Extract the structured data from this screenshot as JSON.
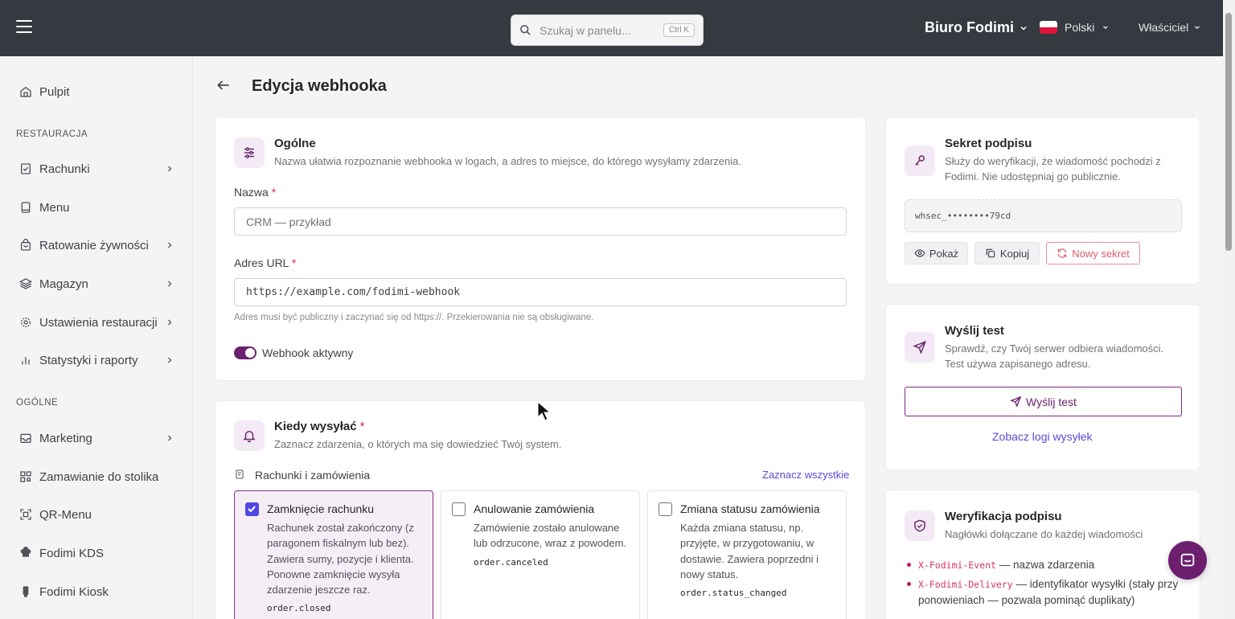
{
  "topbar": {
    "search_placeholder": "Szukaj w panelu...",
    "search_shortcut": "Ctrl K",
    "business_name": "Biuro Fodimi",
    "language": "Polski",
    "role": "Właściciel"
  },
  "sidebar": {
    "dashboard": "Pulpit",
    "section_restaurant": "RESTAURACJA",
    "items_restaurant": [
      {
        "label": "Rachunki",
        "icon": "receipt-icon"
      },
      {
        "label": "Menu",
        "icon": "book-icon"
      },
      {
        "label": "Ratowanie żywności",
        "icon": "bag-icon"
      },
      {
        "label": "Magazyn",
        "icon": "layers-icon"
      },
      {
        "label": "Ustawienia restauracji",
        "icon": "gear-icon"
      },
      {
        "label": "Statystyki i raporty",
        "icon": "chart-icon"
      }
    ],
    "section_general": "OGÓLNE",
    "items_general": [
      {
        "label": "Marketing",
        "icon": "inbox-icon"
      },
      {
        "label": "Zamawianie do stolika",
        "icon": "qr-icon"
      },
      {
        "label": "QR-Menu",
        "icon": "qr-scan-icon"
      },
      {
        "label": "Fodimi KDS",
        "icon": "chef-hat-icon"
      },
      {
        "label": "Fodimi Kiosk",
        "icon": "kiosk-icon"
      }
    ]
  },
  "page": {
    "title": "Edycja webhooka"
  },
  "general": {
    "title": "Ogólne",
    "subtitle": "Nazwa ułatwia rozpoznanie webhooka w logach, a adres to miejsce, do którego wysyłamy zdarzenia.",
    "name_label": "Nazwa",
    "name_value": "CRM — przykład",
    "url_label": "Adres URL",
    "url_value": "https://example.com/fodimi-webhook",
    "url_hint": "Adres musi być publiczny i zaczynać się od https://. Przekierowania nie są obsługiwane.",
    "active_label": "Webhook aktywny",
    "active": true
  },
  "events": {
    "title": "Kiedy wysyłać",
    "subtitle": "Zaznacz zdarzenia, o których ma się dowiedzieć Twój system.",
    "group_title": "Rachunki i zamówienia",
    "select_all": "Zaznacz wszystkie",
    "items": [
      {
        "title": "Zamknięcie rachunku",
        "desc": "Rachunek został zakończony (z paragonem fiskalnym lub bez). Zawiera sumy, pozycje i klienta. Ponowne zamknięcie wysyła zdarzenie jeszcze raz.",
        "code": "order.closed",
        "checked": true
      },
      {
        "title": "Anulowanie zamówienia",
        "desc": "Zamówienie zostało anulowane lub odrzucone, wraz z powodem.",
        "code": "order.canceled",
        "checked": false
      },
      {
        "title": "Zmiana statusu zamówienia",
        "desc": "Każda zmiana statusu, np. przyjęte, w przygotowaniu, w dostawie. Zawiera poprzedni i nowy status.",
        "code": "order.status_changed",
        "checked": false
      }
    ]
  },
  "secret": {
    "title": "Sekret podpisu",
    "subtitle": "Służy do weryfikacji, że wiadomość pochodzi z Fodimi. Nie udostępniaj go publicznie.",
    "value": "whsec_••••••••79cd",
    "show": "Pokaż",
    "copy": "Kopiuj",
    "regenerate": "Nowy sekret"
  },
  "test": {
    "title": "Wyślij test",
    "subtitle": "Sprawdź, czy Twój serwer odbiera wiadomości. Test używa zapisanego adresu.",
    "button": "Wyślij test",
    "logs_link": "Zobacz logi wysyłek"
  },
  "verification": {
    "title": "Weryfikacja podpisu",
    "subtitle": "Nagłówki dołączane do każdej wiadomości",
    "headers": [
      {
        "name": "X-Fodimi-Event",
        "desc": "— nazwa zdarzenia"
      },
      {
        "name": "X-Fodimi-Delivery",
        "desc": "— identyfikator wysyłki (stały przy ponowieniach — pozwala pominąć duplikaty)"
      }
    ]
  },
  "colors": {
    "brand": "#6b1f6e",
    "topbar": "#343a40",
    "link": "#5b4bd8",
    "danger": "#e25a6c"
  }
}
